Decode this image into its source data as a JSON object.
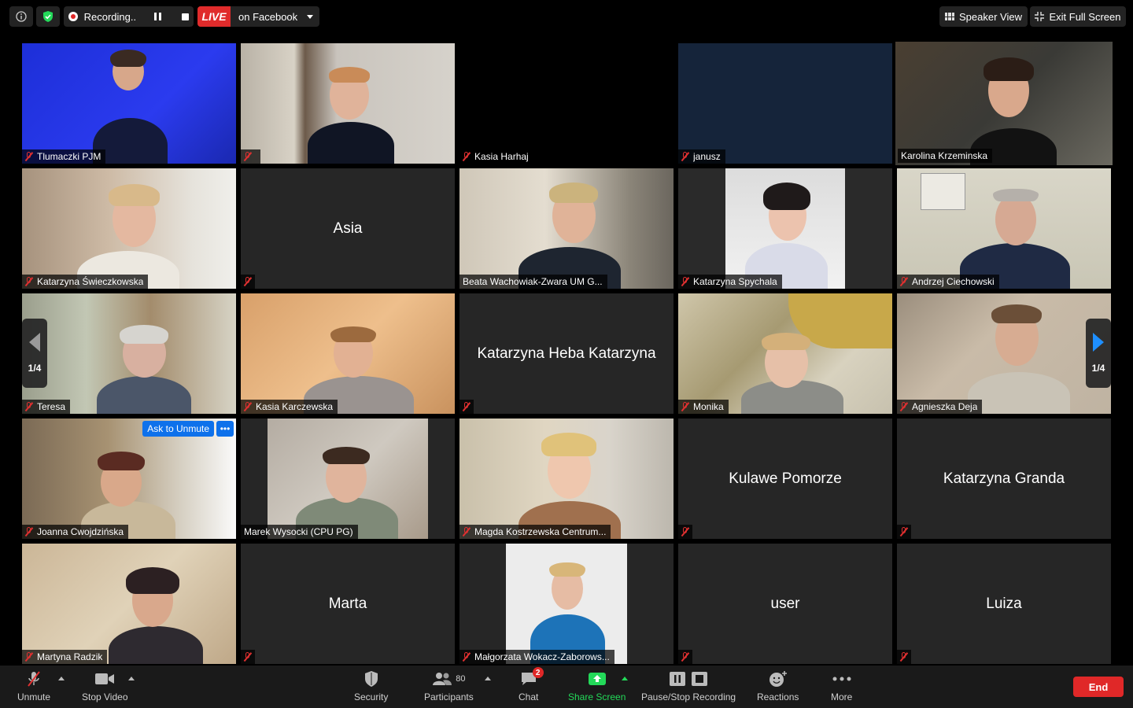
{
  "topbar": {
    "recording_label": "Recording...",
    "live_label": "LIVE",
    "live_target": "on Facebook",
    "speaker_view": "Speaker View",
    "exit_full_screen": "Exit Full Screen"
  },
  "pager": {
    "left_label": "1/4",
    "right_label": "1/4"
  },
  "tiles": [
    {
      "name": "Tlumaczki PJM",
      "video": true
    },
    {
      "name": "",
      "video": true
    },
    {
      "name": "Kasia Harhaj",
      "video": false
    },
    {
      "name": "janusz",
      "video": false
    },
    {
      "name": "Karolina Krzeminska",
      "video": true,
      "active": true
    },
    {
      "name": "Katarzyna Świeczkowska",
      "video": true
    },
    {
      "name": "Asia",
      "video": false
    },
    {
      "name": "Beata Wachowiak-Zwara UM G...",
      "video": true
    },
    {
      "name": "Katarzyna Spychala",
      "video": true
    },
    {
      "name": "Andrzej Ciechowski",
      "video": true
    },
    {
      "name": "Teresa",
      "video": true
    },
    {
      "name": "Kasia Karczewska",
      "video": true
    },
    {
      "name": "Katarzyna Heba Katarzyna",
      "video": false
    },
    {
      "name": "Monika",
      "video": true
    },
    {
      "name": "Agnieszka Deja",
      "video": true
    },
    {
      "name": "Joanna Cwojdzińska",
      "video": true
    },
    {
      "name": "Marek Wysocki (CPU PG)",
      "video": true
    },
    {
      "name": "Magda Kostrzewska Centrum...",
      "video": true
    },
    {
      "name": "Kulawe Pomorze",
      "video": false
    },
    {
      "name": "Katarzyna Granda",
      "video": false
    },
    {
      "name": "Martyna Radzik",
      "video": true
    },
    {
      "name": "Marta",
      "video": false
    },
    {
      "name": "Małgorzata Wokacz-Zaborows...",
      "video": true
    },
    {
      "name": "user",
      "video": false
    },
    {
      "name": "Luiza",
      "video": false
    }
  ],
  "ask_to_unmute": "Ask to Unmute",
  "toolbar": {
    "unmute": "Unmute",
    "stop_video": "Stop Video",
    "security": "Security",
    "participants": "Participants",
    "participants_count": "80",
    "chat": "Chat",
    "chat_badge": "2",
    "share_screen": "Share Screen",
    "pause_stop_recording": "Pause/Stop Recording",
    "reactions": "Reactions",
    "more": "More",
    "end": "End"
  },
  "colors": {
    "active_speaker": "#c7e432",
    "live_red": "#e02b2b",
    "share_green": "#23d959",
    "accent_blue": "#0e71eb"
  }
}
